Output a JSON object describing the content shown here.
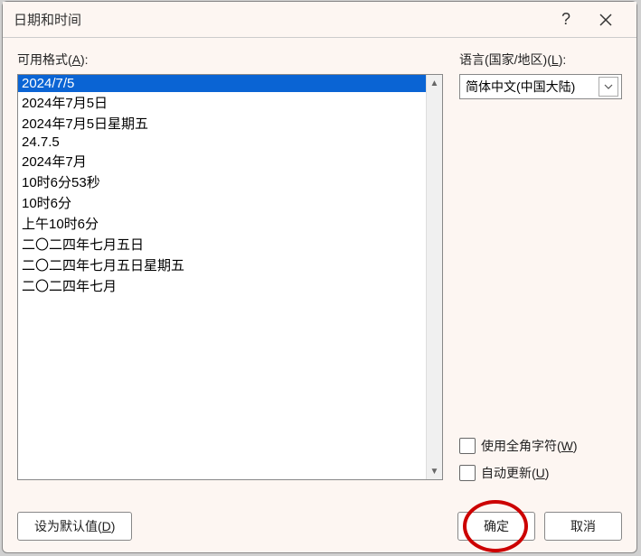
{
  "titlebar": {
    "title": "日期和时间"
  },
  "labels": {
    "format_label": "可用格式(",
    "format_accel": "A",
    "format_label_end": "):",
    "language_label": "语言(国家/地区)(",
    "language_accel": "L",
    "language_label_end": "):"
  },
  "formats": [
    "2024/7/5",
    "2024年7月5日",
    "2024年7月5日星期五",
    "24.7.5",
    "2024年7月",
    "10时6分53秒",
    "10时6分",
    "上午10时6分",
    "二〇二四年七月五日",
    "二〇二四年七月五日星期五",
    "二〇二四年七月"
  ],
  "selected_index": 0,
  "language": {
    "selected": "简体中文(中国大陆)"
  },
  "checkboxes": {
    "fullwidth_label": "使用全角字符(",
    "fullwidth_accel": "W",
    "fullwidth_end": ")",
    "autoupdate_label": "自动更新(",
    "autoupdate_accel": "U",
    "autoupdate_end": ")"
  },
  "buttons": {
    "default_label": "设为默认值(",
    "default_accel": "D",
    "default_end": ")",
    "ok": "确定",
    "cancel": "取消"
  }
}
